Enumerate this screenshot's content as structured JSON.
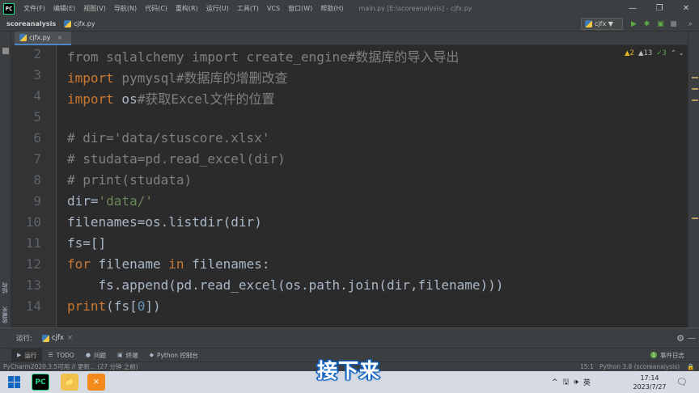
{
  "app": {
    "logo_text": "PC",
    "menu": [
      "文件(F)",
      "编辑(E)",
      "视图(V)",
      "导航(N)",
      "代码(C)",
      "重构(R)",
      "运行(U)",
      "工具(T)",
      "VCS",
      "窗口(W)",
      "帮助(H)"
    ],
    "window_title": "main.py [E:\\scoreanalysis] - cjfx.py",
    "win_controls": [
      "—",
      "❐",
      "✕"
    ]
  },
  "navbar": {
    "project": "scoreanalysis",
    "file": "cjfx.py",
    "run_config": "cjfx ▼"
  },
  "left_strip": {
    "top_label": "项目",
    "bottom_labels": [
      "结构",
      "收藏夹"
    ]
  },
  "tabs": [
    {
      "label": "cjfx.py",
      "close": "×"
    }
  ],
  "editor": {
    "line_numbers": [
      "2",
      "3",
      "4",
      "5",
      "6",
      "7",
      "8",
      "9",
      "10",
      "11",
      "12",
      "13",
      "14"
    ],
    "lines": [
      "from sqlalchemy import create_engine#数据库的导入导出",
      "import pymysql#数据库的增删改查",
      "import os#获取Excel文件的位置",
      "",
      "# dir='data/stuscore.xlsx'",
      "# studata=pd.read_excel(dir)",
      "# print(studata)",
      "dir='data/'",
      "filenames=os.listdir(dir)",
      "fs=[]",
      "for filename in filenames:",
      "    fs.append(pd.read_excel(os.path.join(dir,filename)))",
      "print(fs[0])"
    ],
    "inspections": {
      "warnings": "▲2",
      "weak": "▲13",
      "ok": "✓3",
      "arrows": "⌃ ⌄"
    }
  },
  "run_panel": {
    "label": "运行:",
    "tab": "cjfx",
    "tab_close": "×"
  },
  "tool_windows": [
    {
      "icon": "▶",
      "label": "运行"
    },
    {
      "icon": "☰",
      "label": "TODO"
    },
    {
      "icon": "●",
      "label": "问题"
    },
    {
      "icon": "▣",
      "label": "终端"
    },
    {
      "icon": "◆",
      "label": "Python 控制台"
    }
  ],
  "event_log": {
    "badge": "1",
    "label": "事件日志"
  },
  "status": {
    "message": "PyCharm2020.3.5可用 // 更新... (27 分钟 之前)",
    "position": "15:1",
    "interpreter": "Python 3.8 (scoreanalysis)",
    "lock": "🔒"
  },
  "taskbar": {
    "apps": [
      "PC",
      "📁",
      "✕"
    ],
    "tray": [
      "^",
      "🖫",
      "🕪",
      "英"
    ],
    "time": "17:14",
    "date": "2023/7/27"
  },
  "subtitle": "接下来",
  "colors": {
    "editor_bg": "#2b2b2b",
    "keyword": "#cc7832",
    "comment": "#808080",
    "string": "#6a8759",
    "number": "#6897bb",
    "subtitle_outline": "#1565c0"
  }
}
